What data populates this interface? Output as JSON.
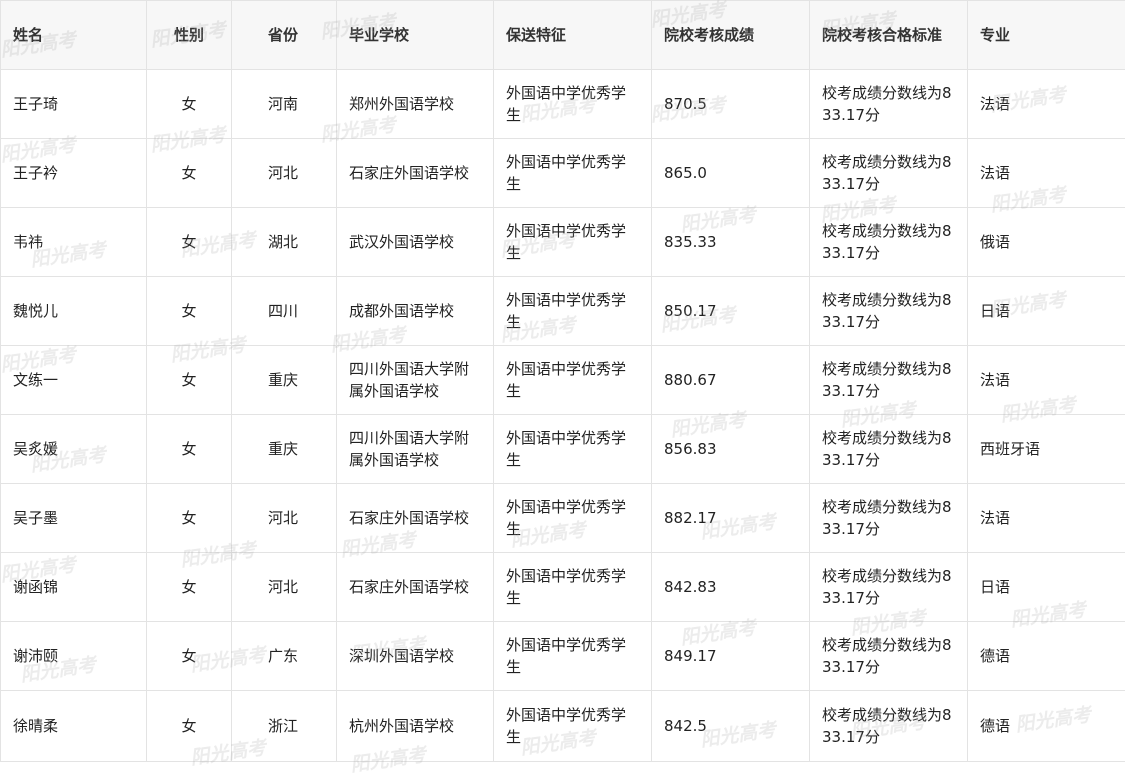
{
  "table": {
    "headers": [
      "姓名",
      "性别",
      "省份",
      "毕业学校",
      "保送特征",
      "院校考核成绩",
      "院校考核合格标准",
      "专业"
    ],
    "rows": [
      [
        "王子琦",
        "女",
        "河南",
        "郑州外国语学校",
        "外国语中学优秀学生",
        "870.5",
        "校考成绩分数线为833.17分",
        "法语"
      ],
      [
        "王子衿",
        "女",
        "河北",
        "石家庄外国语学校",
        "外国语中学优秀学生",
        "865.0",
        "校考成绩分数线为833.17分",
        "法语"
      ],
      [
        "韦祎",
        "女",
        "湖北",
        "武汉外国语学校",
        "外国语中学优秀学生",
        "835.33",
        "校考成绩分数线为833.17分",
        "俄语"
      ],
      [
        "魏悦儿",
        "女",
        "四川",
        "成都外国语学校",
        "外国语中学优秀学生",
        "850.17",
        "校考成绩分数线为833.17分",
        "日语"
      ],
      [
        "文练一",
        "女",
        "重庆",
        "四川外国语大学附属外国语学校",
        "外国语中学优秀学生",
        "880.67",
        "校考成绩分数线为833.17分",
        "法语"
      ],
      [
        "吴炙媛",
        "女",
        "重庆",
        "四川外国语大学附属外国语学校",
        "外国语中学优秀学生",
        "856.83",
        "校考成绩分数线为833.17分",
        "西班牙语"
      ],
      [
        "吴子墨",
        "女",
        "河北",
        "石家庄外国语学校",
        "外国语中学优秀学生",
        "882.17",
        "校考成绩分数线为833.17分",
        "法语"
      ],
      [
        "谢函锦",
        "女",
        "河北",
        "石家庄外国语学校",
        "外国语中学优秀学生",
        "842.83",
        "校考成绩分数线为833.17分",
        "日语"
      ],
      [
        "谢沛颐",
        "女",
        "广东",
        "深圳外国语学校",
        "外国语中学优秀学生",
        "849.17",
        "校考成绩分数线为833.17分",
        "德语"
      ],
      [
        "徐晴柔",
        "女",
        "浙江",
        "杭州外国语学校",
        "外国语中学优秀学生",
        "842.5",
        "校考成绩分数线为833.17分",
        "德语"
      ]
    ]
  },
  "watermark": {
    "text": "阳光高考",
    "color": "#aaaaaa"
  }
}
